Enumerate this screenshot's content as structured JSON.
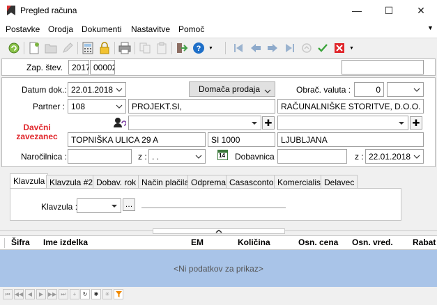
{
  "window": {
    "title": "Pregled računa",
    "minimize_glyph": "—",
    "maximize_glyph": "☐",
    "close_glyph": "✕"
  },
  "menu": [
    "Postavke",
    "Orodja",
    "Dokumenti",
    "Nastavitve",
    "Pomoč"
  ],
  "header": {
    "doc_no_label": "Zap. štev.",
    "doc_year": "2017",
    "doc_no": "00002",
    "doc_extra": ""
  },
  "form": {
    "date_label": "Datum dok.:",
    "date_value": "22.01.2018",
    "sale_type": "Domača prodaja",
    "currency_label": "Obrač. valuta :",
    "currency_value": "0",
    "currency_select": "",
    "partner_label": "Partner :",
    "partner_code": "108",
    "partner_name": "PROJEKT.SI,",
    "partner_fullname": "RAČUNALNIŠKE STORITVE, D.O.O.",
    "taxpayer_label": "Davčni zavezanec",
    "street": "TOPNIŠKA ULICA 29 A",
    "postal_code": "SI 1000",
    "city": "LJUBLJANA",
    "order_label": "Naročilnica :",
    "order_value": "",
    "z_label": "z :",
    "order_date": ". .",
    "calendar_badge": "14",
    "delivery_label": "Dobavnica :",
    "delivery_value": "",
    "delivery_z_label": "z :",
    "delivery_date": "22.01.2018"
  },
  "tabs": [
    "Klavzula",
    "Klavzula #2",
    "Dobav. rok",
    "Način plačila",
    "Odprema",
    "Casasconto",
    "Komercialist",
    "Delavec"
  ],
  "clause": {
    "label": "Klavzula :",
    "value": "",
    "ellipsis": "…"
  },
  "grid": {
    "columns": [
      "Šifra",
      "Ime izdelka",
      "EM",
      "Količina",
      "Osn. cena",
      "Osn. vred.",
      "Rabat"
    ],
    "empty_text": "<Ni podatkov za prikaz>"
  },
  "colors": {
    "accent_red": "#e0262b",
    "grid_empty_bg": "#a9c4e8",
    "confirm_green": "#3aa33a"
  }
}
